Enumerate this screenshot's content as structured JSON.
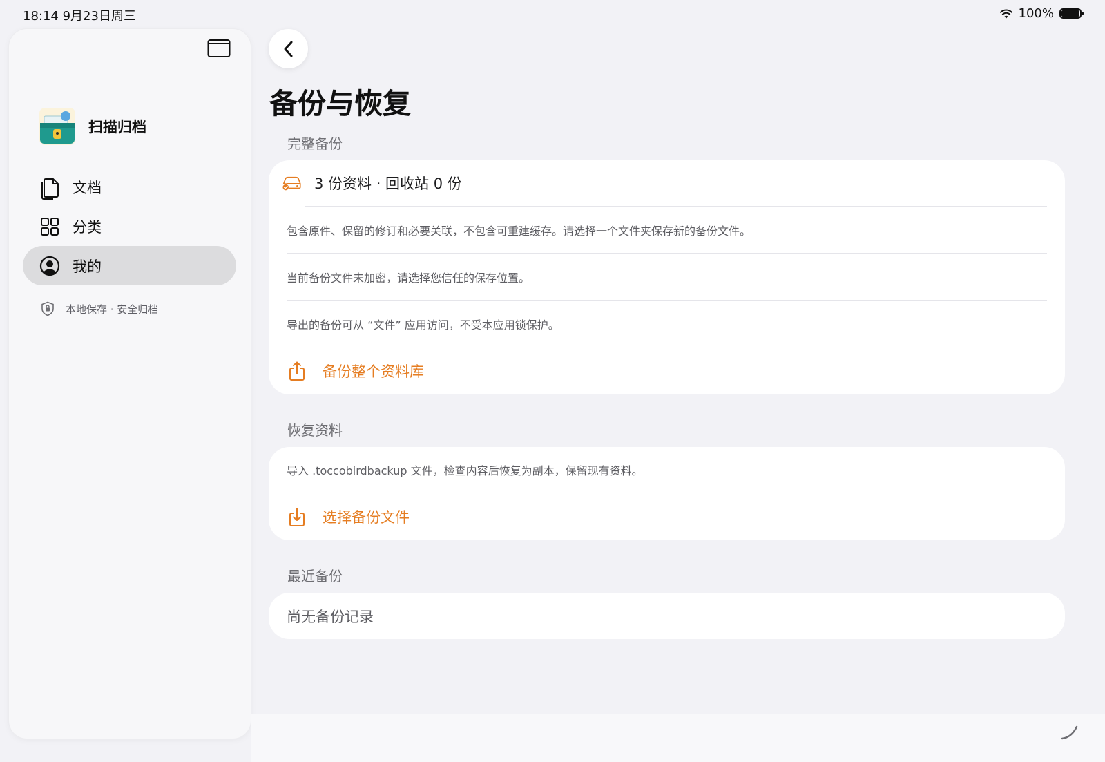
{
  "status_bar": {
    "time": "18:14 9月23日周三",
    "battery": "100%"
  },
  "sidebar": {
    "app_name": "扫描归档",
    "nav": [
      {
        "label": "文档",
        "icon": "documents-icon"
      },
      {
        "label": "分类",
        "icon": "grid-icon"
      },
      {
        "label": "我的",
        "icon": "person-circle-icon",
        "active": true
      }
    ],
    "footer": "本地保存 · 安全归档"
  },
  "main": {
    "title": "备份与恢复",
    "full_backup": {
      "section_title": "完整备份",
      "summary": "3 份资料 · 回收站 0 份",
      "notes": [
        "包含原件、保留的修订和必要关联，不包含可重建缓存。请选择一个文件夹保存新的备份文件。",
        "当前备份文件未加密，请选择您信任的保存位置。",
        "导出的备份可从 “文件” 应用访问，不受本应用锁保护。"
      ],
      "action": "备份整个资料库"
    },
    "restore": {
      "section_title": "恢复资料",
      "note": "导入 .toccobirdbackup 文件，检查内容后恢复为副本，保留现有资料。",
      "action": "选择备份文件"
    },
    "recent": {
      "section_title": "最近备份",
      "empty": "尚无备份记录"
    }
  },
  "colors": {
    "accent": "#e57d22",
    "background": "#f2f2f6",
    "card": "#ffffff",
    "active_nav": "#dcdcde"
  }
}
